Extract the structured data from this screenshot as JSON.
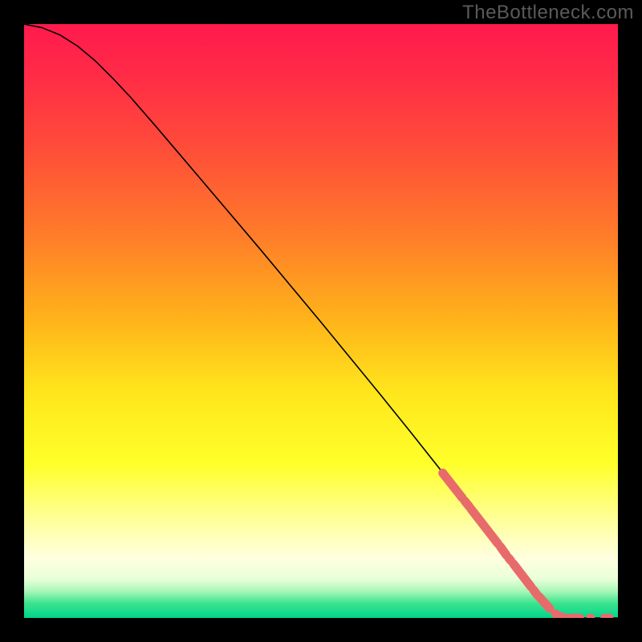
{
  "watermark": "TheBottleneck.com",
  "chart_data": {
    "type": "line",
    "title": "",
    "xlabel": "",
    "ylabel": "",
    "xlim": [
      0,
      100
    ],
    "ylim": [
      0,
      100
    ],
    "background_gradient_stops": [
      {
        "offset": 0.0,
        "color": "#ff1a4d"
      },
      {
        "offset": 0.08,
        "color": "#ff2a47"
      },
      {
        "offset": 0.2,
        "color": "#ff4a3a"
      },
      {
        "offset": 0.35,
        "color": "#ff7a2a"
      },
      {
        "offset": 0.5,
        "color": "#ffb41a"
      },
      {
        "offset": 0.62,
        "color": "#ffe61c"
      },
      {
        "offset": 0.74,
        "color": "#ffff2a"
      },
      {
        "offset": 0.84,
        "color": "#ffffa0"
      },
      {
        "offset": 0.9,
        "color": "#ffffe0"
      },
      {
        "offset": 0.935,
        "color": "#e8ffd8"
      },
      {
        "offset": 0.955,
        "color": "#a8f7b8"
      },
      {
        "offset": 0.975,
        "color": "#3de48e"
      },
      {
        "offset": 1.0,
        "color": "#00d68a"
      }
    ],
    "curve": [
      {
        "x": 0,
        "y": 100.0
      },
      {
        "x": 3,
        "y": 99.4
      },
      {
        "x": 6,
        "y": 98.2
      },
      {
        "x": 9,
        "y": 96.3
      },
      {
        "x": 12,
        "y": 93.8
      },
      {
        "x": 15,
        "y": 90.8
      },
      {
        "x": 18,
        "y": 87.6
      },
      {
        "x": 22,
        "y": 83.0
      },
      {
        "x": 26,
        "y": 78.3
      },
      {
        "x": 30,
        "y": 73.6
      },
      {
        "x": 35,
        "y": 67.7
      },
      {
        "x": 40,
        "y": 61.8
      },
      {
        "x": 45,
        "y": 55.8
      },
      {
        "x": 50,
        "y": 49.8
      },
      {
        "x": 55,
        "y": 43.7
      },
      {
        "x": 60,
        "y": 37.6
      },
      {
        "x": 65,
        "y": 31.4
      },
      {
        "x": 70,
        "y": 25.1
      },
      {
        "x": 74,
        "y": 20.0
      },
      {
        "x": 78,
        "y": 14.8
      },
      {
        "x": 82,
        "y": 9.6
      },
      {
        "x": 85,
        "y": 5.7
      },
      {
        "x": 87,
        "y": 3.3
      },
      {
        "x": 88.5,
        "y": 1.8
      },
      {
        "x": 89.6,
        "y": 0.9
      },
      {
        "x": 90.2,
        "y": 0.4
      },
      {
        "x": 90.8,
        "y": 0.1
      },
      {
        "x": 91.5,
        "y": 0.0
      },
      {
        "x": 100,
        "y": 0.0
      }
    ],
    "highlight_segments": [
      {
        "x1": 70.5,
        "y1": 24.4,
        "x2": 73.8,
        "y2": 20.2
      },
      {
        "x1": 74.2,
        "y1": 19.7,
        "x2": 75.0,
        "y2": 18.7
      },
      {
        "x1": 75.3,
        "y1": 18.3,
        "x2": 79.8,
        "y2": 12.5
      },
      {
        "x1": 80.2,
        "y1": 12.0,
        "x2": 81.2,
        "y2": 10.6
      },
      {
        "x1": 81.6,
        "y1": 10.1,
        "x2": 82.0,
        "y2": 9.6
      },
      {
        "x1": 82.4,
        "y1": 9.1,
        "x2": 85.4,
        "y2": 5.2
      },
      {
        "x1": 85.8,
        "y1": 4.7,
        "x2": 86.4,
        "y2": 3.9
      },
      {
        "x1": 86.7,
        "y1": 3.6,
        "x2": 88.5,
        "y2": 1.6
      }
    ],
    "highlight_dots": [
      {
        "x": 89.5,
        "y": 0.7
      },
      {
        "x": 90.2,
        "y": 0.3
      },
      {
        "x": 90.9,
        "y": 0.05
      },
      {
        "x": 91.6,
        "y": 0.0
      },
      {
        "x": 92.4,
        "y": 0.0
      },
      {
        "x": 93.0,
        "y": 0.0
      },
      {
        "x": 93.6,
        "y": 0.0
      },
      {
        "x": 95.4,
        "y": 0.0
      },
      {
        "x": 97.8,
        "y": 0.0
      },
      {
        "x": 98.5,
        "y": 0.0
      }
    ],
    "marker_style": {
      "color": "#e86b6b",
      "radius_px": 5.5
    }
  }
}
